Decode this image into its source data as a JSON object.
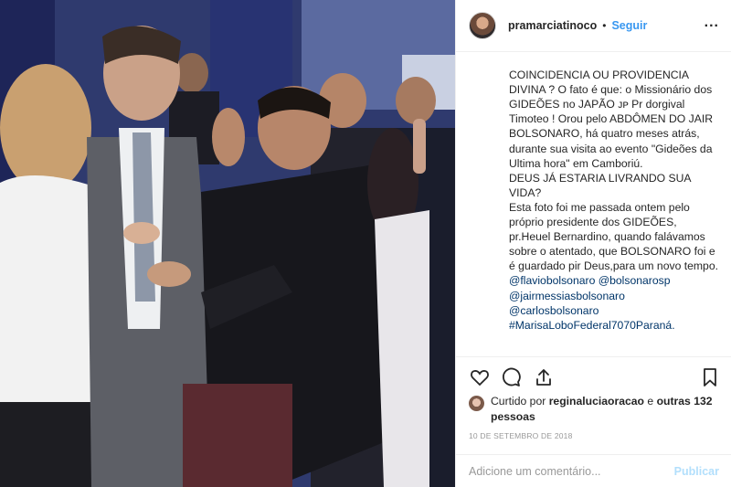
{
  "header": {
    "username": "pramarciatinoco",
    "separator": "•",
    "follow_label": "Seguir",
    "more_label": "..."
  },
  "caption": {
    "text": "COINCIDENCIA OU PROVIDENCIA DIVINA ? O fato é que: o Missionário dos GIDEÕES no JAPÃO ᴊᴘ Pr dorgival Timoteo ! Orou pelo ABDÔMEN DO JAIR BOLSONARO, há quatro meses atrás, durante sua visita ao evento \"Gideões da Ultima hora\" em Camboriú.\nDEUS JÁ ESTARIA LIVRANDO SUA VIDA?\nEsta foto foi me passada ontem pelo próprio presidente dos GIDEÕES, pr.Heuel Bernardino, quando falávamos sobre o atentado, que BOLSONARO foi e é guardado pir Deus,para um novo tempo.",
    "tags": [
      "@flaviobolsonaro @bolsonarosp",
      "@jairmessiasbolsonaro",
      "@carlosbolsonaro",
      "#MarisaLoboFederal7070Paraná."
    ]
  },
  "actions": {
    "like_icon": "heart-icon",
    "comment_icon": "comment-icon",
    "share_icon": "share-icon",
    "save_icon": "bookmark-icon"
  },
  "likes": {
    "prefix": "Curtido por ",
    "user": "reginaluciaoracao",
    "mid": " e ",
    "others": "outras 132 pessoas"
  },
  "date": "10 DE SETEMBRO DE 2018",
  "comment": {
    "placeholder": "Adicione um comentário...",
    "publish_label": "Publicar"
  },
  "colors": {
    "link": "#3897f0",
    "tag": "#003569",
    "muted": "#999999",
    "publish_disabled": "#b2dffc"
  }
}
